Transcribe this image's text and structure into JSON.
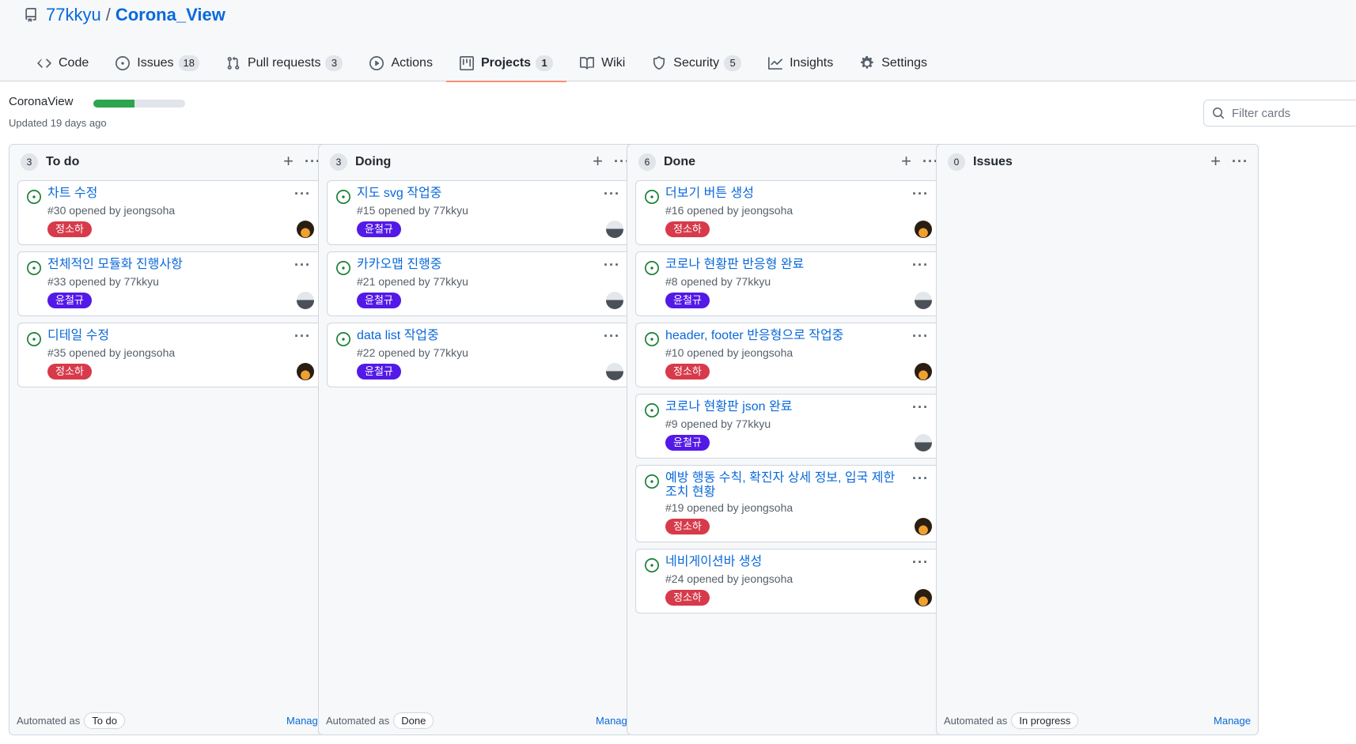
{
  "repo": {
    "owner": "77kkyu",
    "separator": "/",
    "name": "Corona_View"
  },
  "tabs": [
    {
      "label": "Code",
      "icon": "code-icon",
      "count": ""
    },
    {
      "label": "Issues",
      "icon": "issue-opened-icon",
      "count": "18"
    },
    {
      "label": "Pull requests",
      "icon": "git-pull-request-icon",
      "count": "3"
    },
    {
      "label": "Actions",
      "icon": "play-icon",
      "count": ""
    },
    {
      "label": "Projects",
      "icon": "project-icon",
      "count": "1"
    },
    {
      "label": "Wiki",
      "icon": "book-icon",
      "count": ""
    },
    {
      "label": "Security",
      "icon": "shield-icon",
      "count": "5"
    },
    {
      "label": "Insights",
      "icon": "graph-icon",
      "count": ""
    },
    {
      "label": "Settings",
      "icon": "gear-icon",
      "count": ""
    }
  ],
  "project": {
    "name": "CoronaView",
    "updated": "Updated 19 days ago",
    "progress_fraction": 0.45
  },
  "filter": {
    "placeholder": "Filter cards"
  },
  "colors": {
    "label_jeong": "#d73a4a",
    "label_kkyu": "#5319e7",
    "link": "#0969da",
    "open_icon": "#1a7f37"
  },
  "columns": [
    {
      "count": "3",
      "title": "To do",
      "footer": {
        "prefix": "Automated as",
        "badge": "To do",
        "manage": "Manage"
      },
      "cards": [
        {
          "title": "차트 수정",
          "meta": "#30 opened by jeongsoha",
          "label": "정소하",
          "owner": "jeong"
        },
        {
          "title": "전체적인 모듈화 진행사항",
          "meta": "#33 opened by 77kkyu",
          "label": "윤철규",
          "owner": "kkyu"
        },
        {
          "title": "디테일 수정",
          "meta": "#35 opened by jeongsoha",
          "label": "정소하",
          "owner": "jeong"
        }
      ]
    },
    {
      "count": "3",
      "title": "Doing",
      "footer": {
        "prefix": "Automated as",
        "badge": "Done",
        "manage": "Manage"
      },
      "cards": [
        {
          "title": "지도 svg 작업중",
          "meta": "#15 opened by 77kkyu",
          "label": "윤철규",
          "owner": "kkyu"
        },
        {
          "title": "카카오맵 진행중",
          "meta": "#21 opened by 77kkyu",
          "label": "윤철규",
          "owner": "kkyu"
        },
        {
          "title": "data list 작업중",
          "meta": "#22 opened by 77kkyu",
          "label": "윤철규",
          "owner": "kkyu"
        }
      ]
    },
    {
      "count": "6",
      "title": "Done",
      "footer": {
        "prefix": "",
        "badge": "",
        "manage": ""
      },
      "cards": [
        {
          "title": "더보기 버튼 생성",
          "meta": "#16 opened by jeongsoha",
          "label": "정소하",
          "owner": "jeong"
        },
        {
          "title": "코로나 현황판 반응형 완료",
          "meta": "#8 opened by 77kkyu",
          "label": "윤철규",
          "owner": "kkyu"
        },
        {
          "title": "header, footer 반응형으로 작업중",
          "meta": "#10 opened by jeongsoha",
          "label": "정소하",
          "owner": "jeong"
        },
        {
          "title": "코로나 현황판 json 완료",
          "meta": "#9 opened by 77kkyu",
          "label": "윤철규",
          "owner": "kkyu"
        },
        {
          "title": "예방 행동 수칙, 확진자 상세 정보, 입국 제한조치 현황",
          "meta": "#19 opened by jeongsoha",
          "label": "정소하",
          "owner": "jeong"
        },
        {
          "title": "네비게이션바 생성",
          "meta": "#24 opened by jeongsoha",
          "label": "정소하",
          "owner": "jeong"
        }
      ]
    },
    {
      "count": "0",
      "title": "Issues",
      "footer": {
        "prefix": "Automated as",
        "badge": "In progress",
        "manage": "Manage"
      },
      "cards": []
    }
  ]
}
